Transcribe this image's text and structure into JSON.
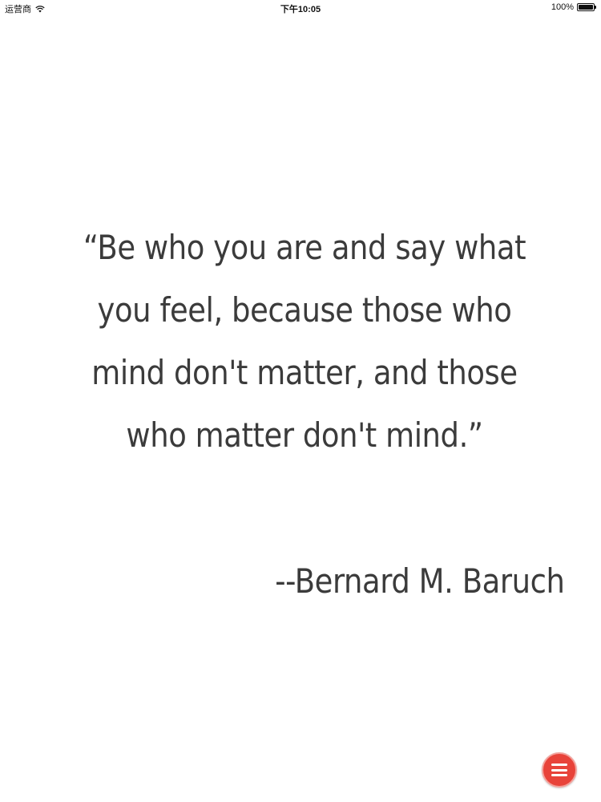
{
  "status_bar": {
    "carrier": "运营商",
    "time": "下午10:05",
    "battery": "100%",
    "battery_level": 1.0,
    "wifi_icon": "wifi-icon",
    "battery_icon": "battery-icon"
  },
  "quote": {
    "text": "“Be who you are and say what you feel, because those who mind don't matter, and those who matter don't mind.”",
    "author": "--Bernard M. Baruch"
  },
  "menu_button": {
    "icon": "hamburger-menu-icon",
    "color": "#e8433a"
  }
}
